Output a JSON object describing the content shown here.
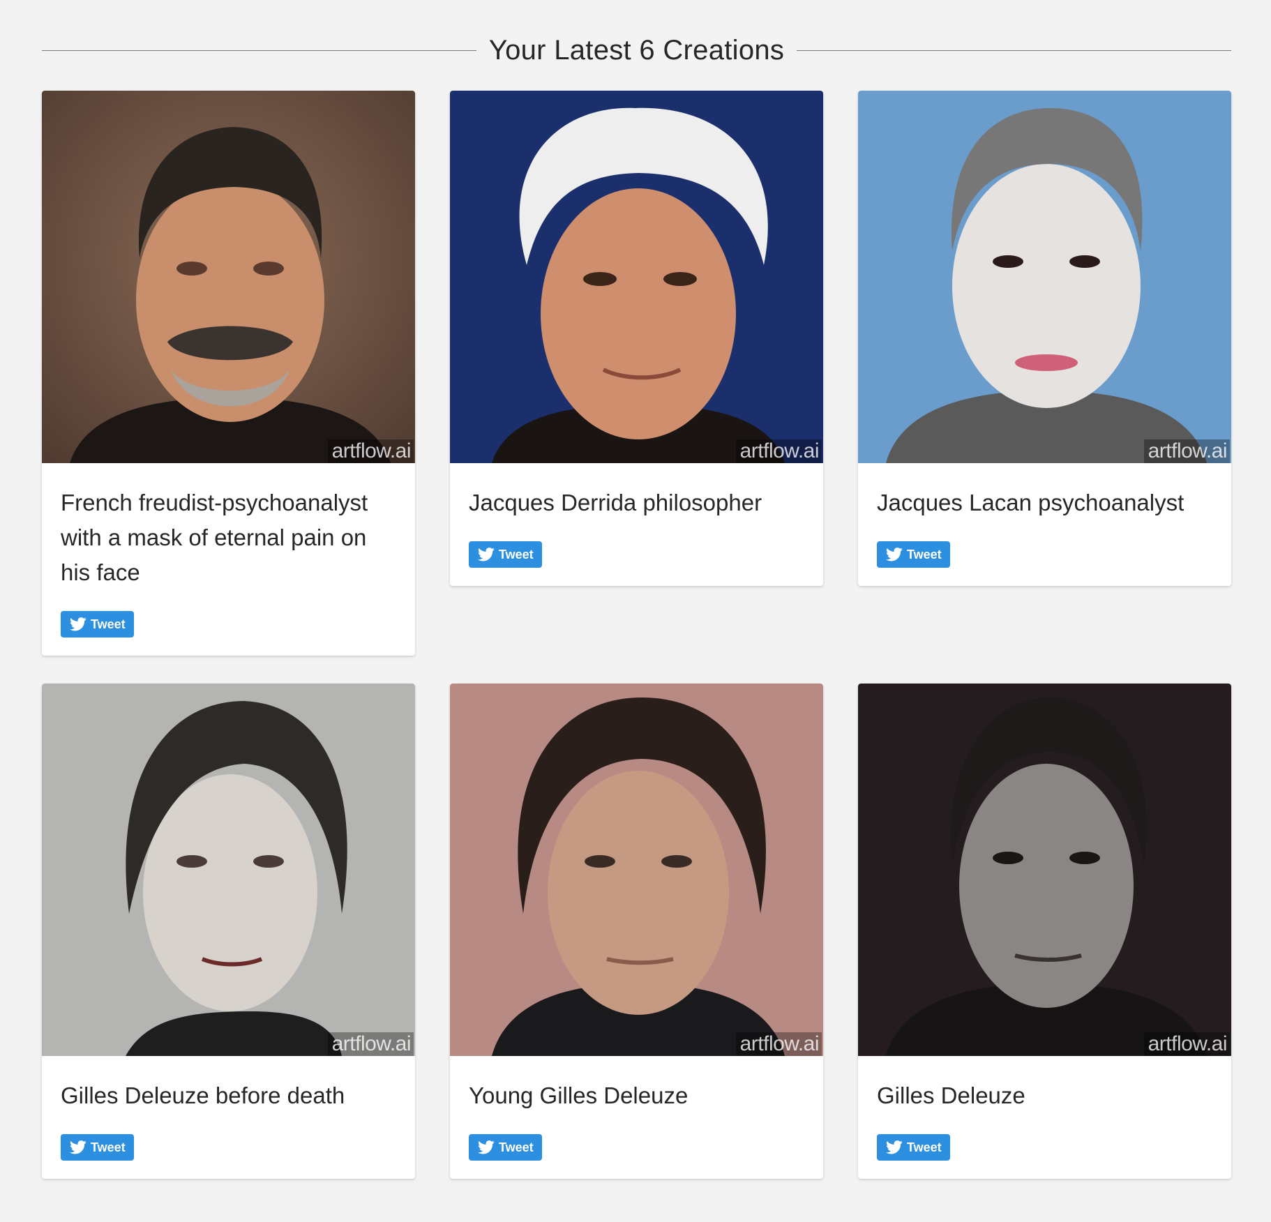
{
  "header": {
    "title": "Your Latest 6 Creations"
  },
  "watermark": "artflow.ai",
  "tweet_label": "Tweet",
  "colors": {
    "tweet": "#2d8fe0",
    "background": "#f3f3f3",
    "card": "#ffffff"
  },
  "creations": [
    {
      "title": "French freudist-psychoanalyst with a mask of eternal pain on his face"
    },
    {
      "title": "Jacques Derrida philosopher"
    },
    {
      "title": "Jacques Lacan psychoanalyst"
    },
    {
      "title": "Gilles Deleuze before death"
    },
    {
      "title": "Young Gilles Deleuze"
    },
    {
      "title": "Gilles Deleuze"
    }
  ]
}
